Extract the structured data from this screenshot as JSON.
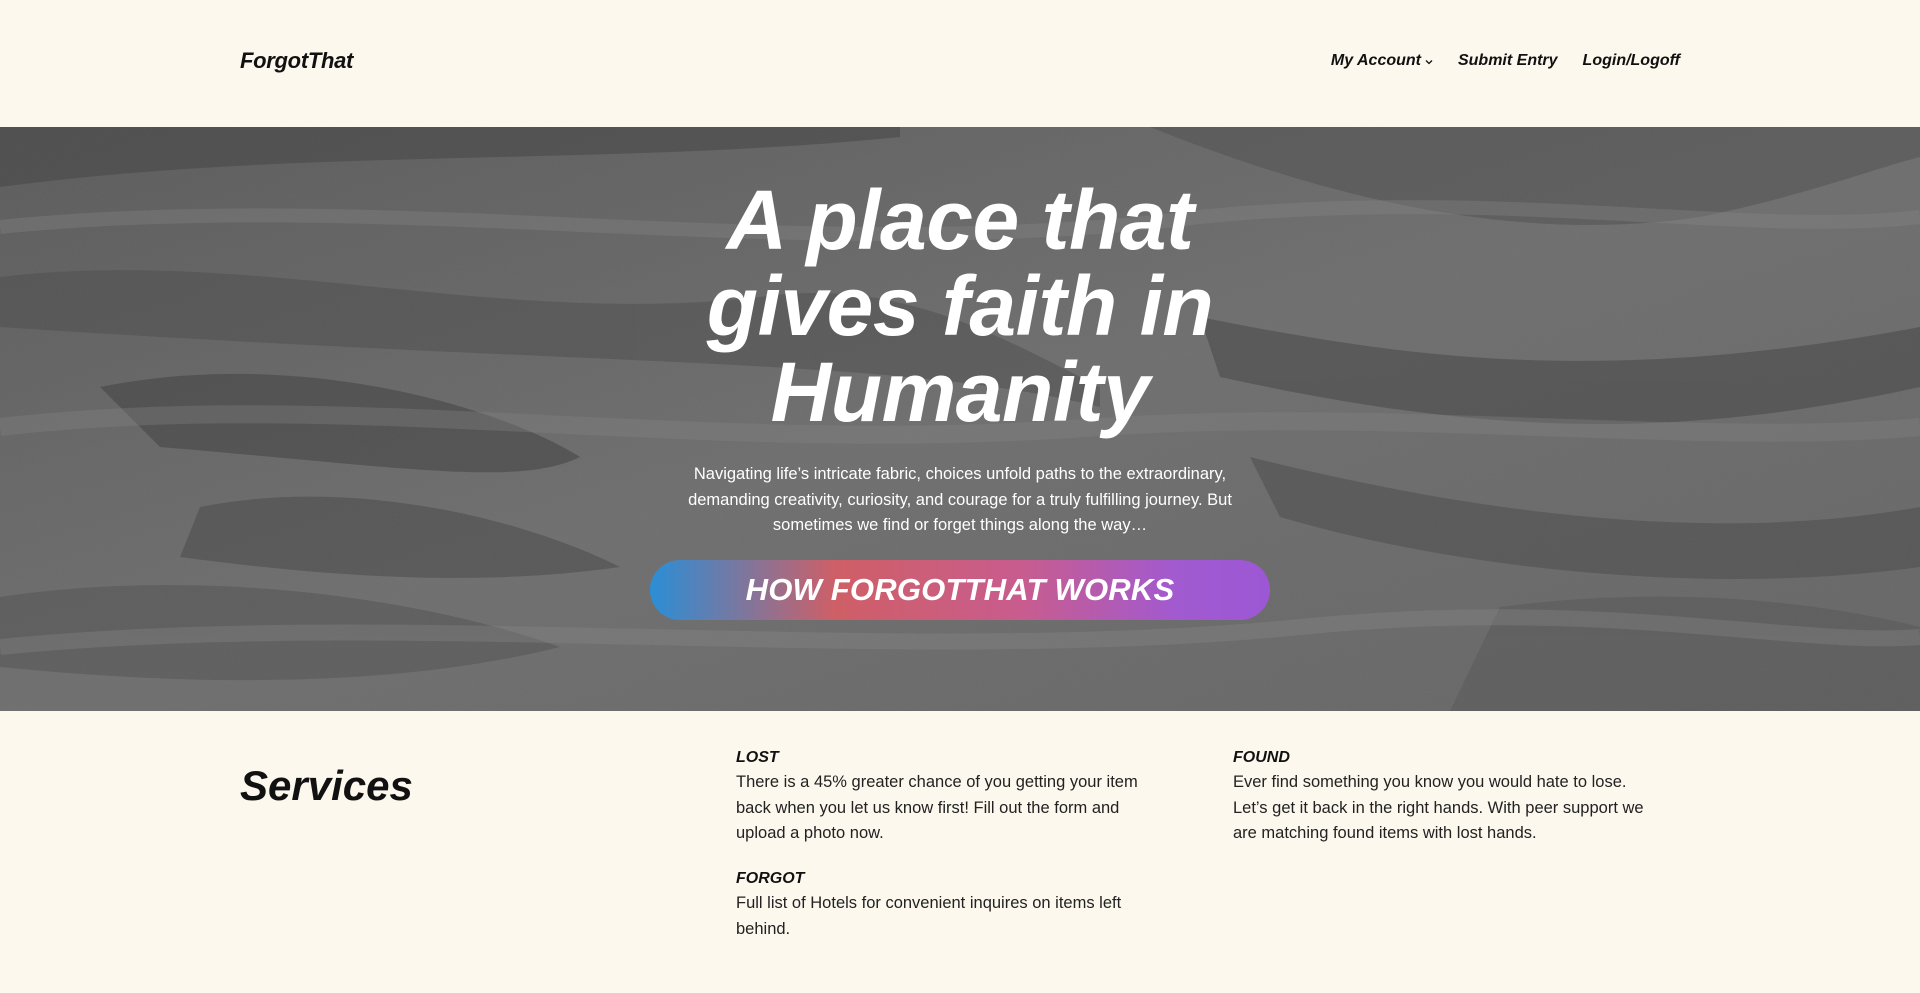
{
  "header": {
    "logo": "ForgotThat",
    "nav": [
      {
        "label": "My Account",
        "has_dropdown": true
      },
      {
        "label": "Submit Entry",
        "has_dropdown": false
      },
      {
        "label": "Login/Logoff",
        "has_dropdown": false
      }
    ]
  },
  "hero": {
    "title_lines": [
      "A place that",
      "gives faith in",
      "Humanity"
    ],
    "subtitle": "Navigating life’s intricate fabric, choices unfold paths to the extraordinary, demanding creativity, curiosity, and courage for a truly fulfilling journey. But sometimes we find or forget things along the way…",
    "cta_label": "HOW FORGOTTHAT WORKS",
    "cta_gradient": [
      "#2b8ed6",
      "#cf5f66",
      "#c85c8e",
      "#9c57d4"
    ]
  },
  "services": {
    "title": "Services",
    "items": [
      {
        "heading": "LOST",
        "text": "There is a 45% greater chance of you getting your item back when you let us know first! Fill out the form and upload a photo now."
      },
      {
        "heading": "FORGOT",
        "text": "Full list of Hotels for convenient inquires on items left behind."
      },
      {
        "heading": "FOUND",
        "text": "Ever find something you know you would hate to lose. Let’s get it back in the right hands. With peer support we are matching found items with lost hands."
      }
    ]
  },
  "colors": {
    "page_background": "#fcf8ee",
    "text": "#111111",
    "hero_overlay": "#6a6a6a"
  }
}
